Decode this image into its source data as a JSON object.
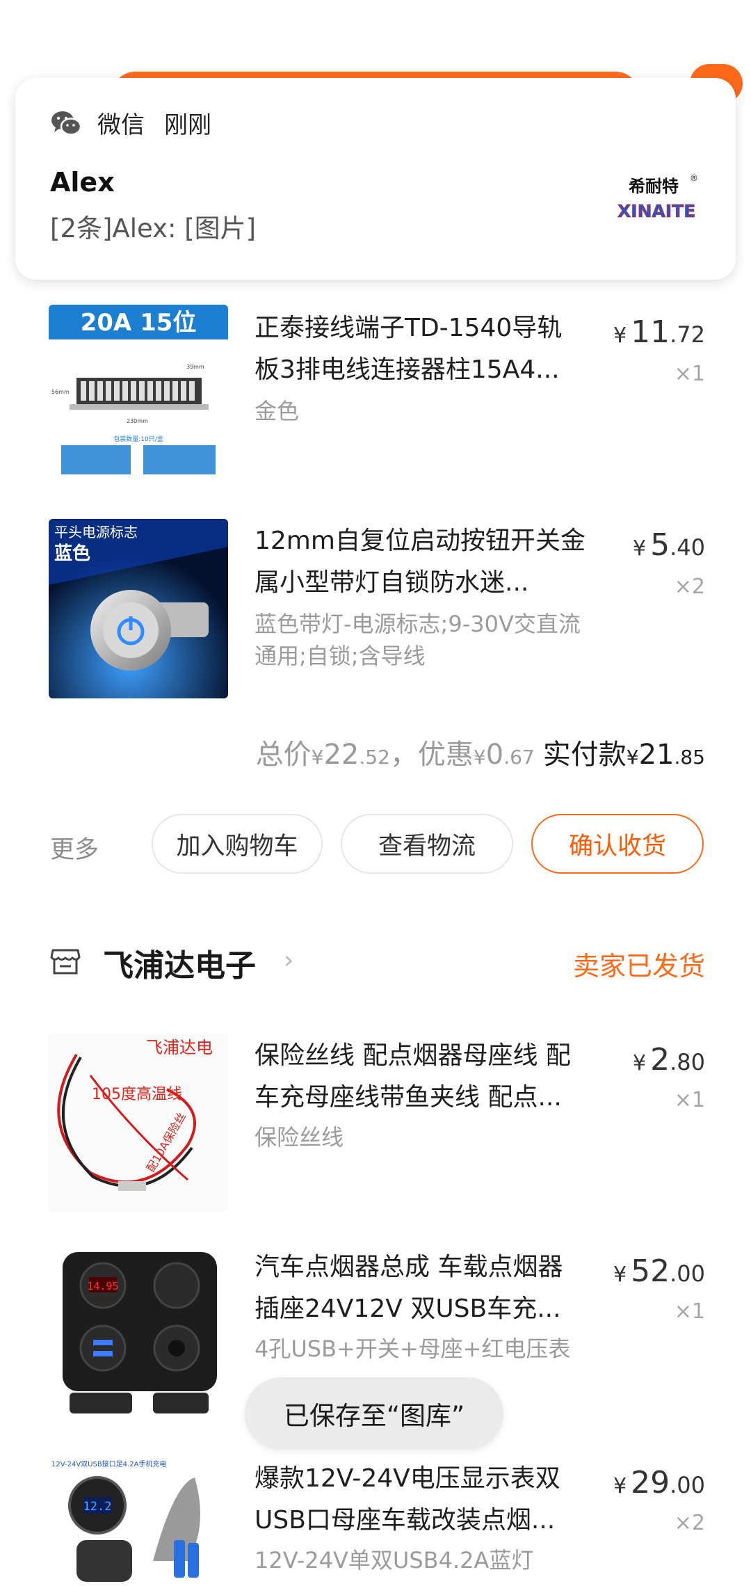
{
  "notification": {
    "app_name": "微信",
    "time": "刚刚",
    "title": "Alex",
    "body": "[2条]Alex: [图片]",
    "logo_cn": "希耐特",
    "logo_en": "XINAITE",
    "logo_reg": "®"
  },
  "order1": {
    "items": [
      {
        "thumb_banner": "20A 15位",
        "thumb_dims": [
          "39mm",
          "230mm",
          "56mm"
        ],
        "thumb_pack": "包装数量:10只/盒",
        "title_line1": "正泰接线端子TD-1540导轨",
        "title_line2": "板3排电线连接器柱15A4...",
        "attr": "金色",
        "price_int": "11",
        "price_dec": ".72",
        "qty": "×1"
      },
      {
        "thumb_label_1": "平头电源标志",
        "thumb_label_2": "蓝色",
        "title_line1": "12mm自复位启动按钮开关金",
        "title_line2": "属小型带灯自锁防水迷...",
        "attr_line1": "蓝色带灯-电源标志;9-30V交直流",
        "attr_line2": "通用;自锁;含导线",
        "price_int": "5",
        "price_dec": ".40",
        "qty": "×2"
      }
    ],
    "totals": {
      "total_label": "总价",
      "total_int": "22",
      "total_dec": ".52",
      "discount_label": "，优惠",
      "discount_int": "0",
      "discount_dec": ".67",
      "paid_label": "实付款",
      "paid_int": "21",
      "paid_dec": ".85",
      "currency": "¥"
    },
    "actions": {
      "more": "更多",
      "add_cart": "加入购物车",
      "logistics": "查看物流",
      "confirm": "确认收货"
    }
  },
  "order2": {
    "shop_name": "飞浦达电子",
    "status": "卖家已发货",
    "items": [
      {
        "thumb_text_1": "飞浦达电",
        "thumb_text_2": "105度高温线",
        "thumb_text_3": "配10A保险丝",
        "title_line1": "保险丝线 配点烟器母座线 配",
        "title_line2": "车充母座线带鱼夹线 配点...",
        "attr": "保险丝线",
        "price_int": "2",
        "price_dec": ".80",
        "qty": "×1"
      },
      {
        "thumb_display": "14.95",
        "title_line1": "汽车点烟器总成 车载点烟器",
        "title_line2": "插座24V12V 双USB车充...",
        "attr": "4孔USB+开关+母座+红电压表",
        "price_int": "52",
        "price_dec": ".00",
        "qty": "×1"
      },
      {
        "thumb_header": "12V-24V双USB接口足4.2A手机充电",
        "thumb_display": "12.2",
        "title_line1": "爆款12V-24V电压显示表双",
        "title_line2": "USB口母座车载改装点烟...",
        "attr": "12V-24V单双USB4.2A蓝灯",
        "price_int": "29",
        "price_dec": ".00",
        "qty": "×2"
      }
    ]
  },
  "toast": "已保存至“图库”",
  "colors": {
    "accent": "#ff6a1a",
    "muted": "#9b9b9b"
  }
}
